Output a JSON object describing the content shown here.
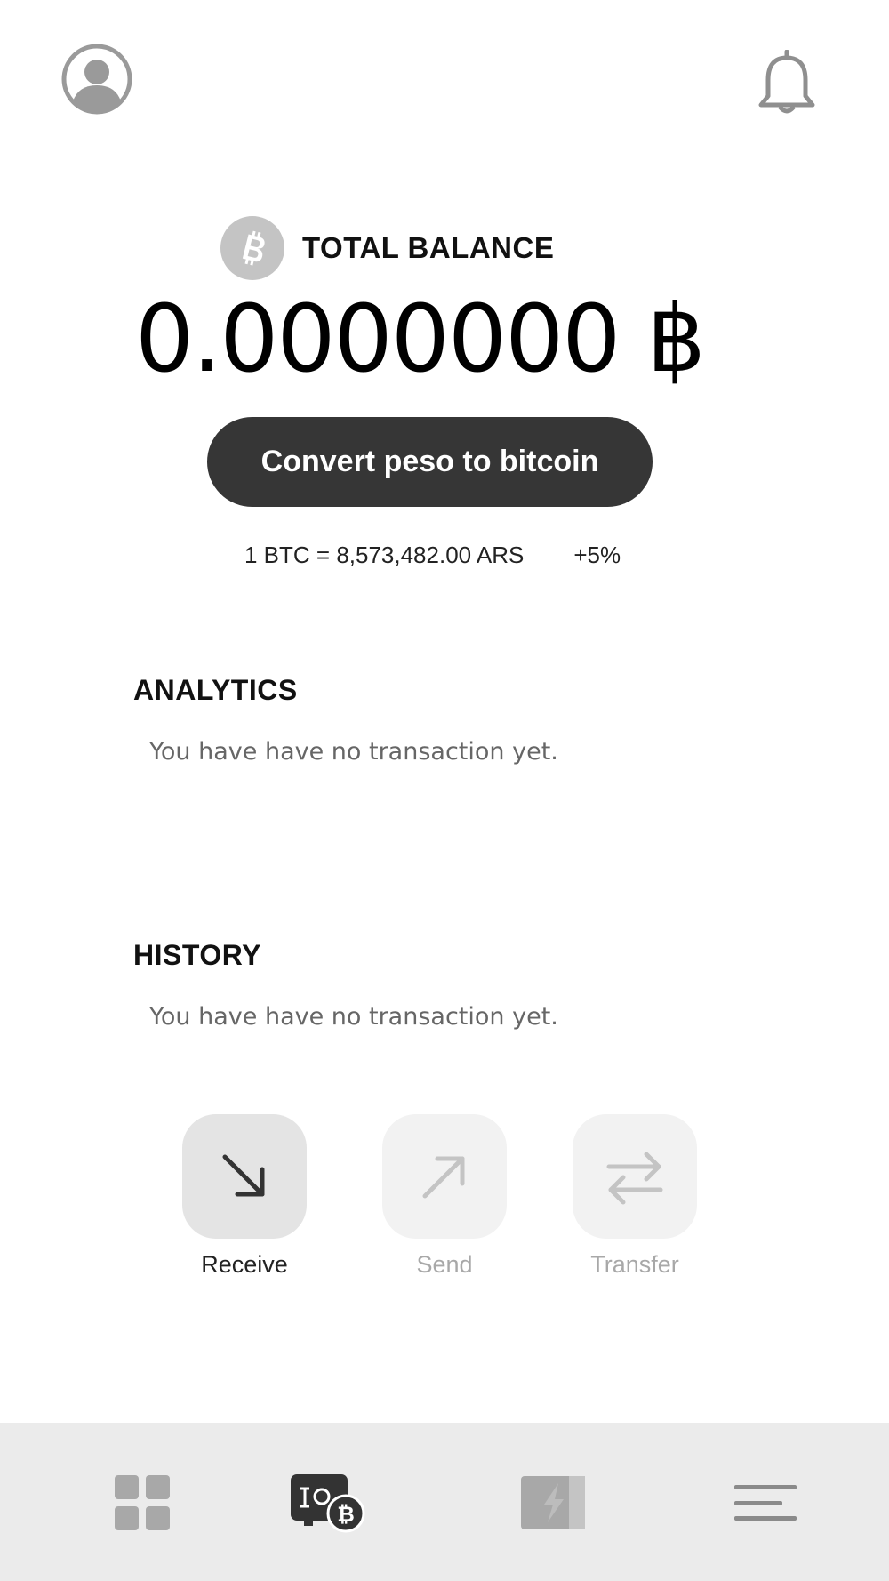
{
  "header": {
    "profile_icon": "user-circle-icon",
    "notification_icon": "bell-icon"
  },
  "balance": {
    "icon": "bitcoin-icon",
    "title": "TOTAL BALANCE",
    "amount": "0.0000000 ฿",
    "convert_label": "Convert peso to bitcoin",
    "rate": "1 BTC = 8,573,482.00 ARS",
    "rate_change": "+5%"
  },
  "analytics": {
    "title": "ANALYTICS",
    "empty_message": "You have have no transaction yet."
  },
  "history": {
    "title": "HISTORY",
    "empty_message": "You have have no transaction yet."
  },
  "actions": [
    {
      "label": "Receive",
      "icon": "arrow-down-right-icon",
      "active": true
    },
    {
      "label": "Send",
      "icon": "arrow-up-right-icon",
      "active": false
    },
    {
      "label": "Transfer",
      "icon": "swap-arrows-icon",
      "active": false
    }
  ],
  "bottom_nav": [
    {
      "icon": "dashboard-grid-icon",
      "active": false
    },
    {
      "icon": "wallet-bitcoin-icon",
      "active": true
    },
    {
      "icon": "lightning-icon",
      "active": false
    },
    {
      "icon": "menu-icon",
      "active": false
    }
  ],
  "colors": {
    "button_dark": "#363636",
    "badge_gray": "#c4c4c4",
    "nav_bg": "#ebebeb",
    "inactive_text": "#a8a8a8"
  }
}
